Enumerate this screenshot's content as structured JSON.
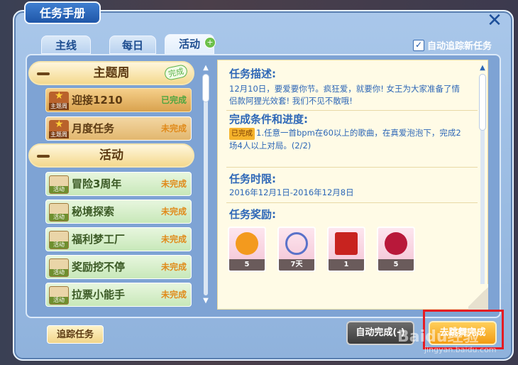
{
  "window": {
    "title": "任务手册",
    "close_icon": "close-icon"
  },
  "tabs": [
    {
      "label": "主线"
    },
    {
      "label": "每日"
    },
    {
      "label": "活动",
      "active": true
    }
  ],
  "auto_track": {
    "label": "自动追踪新任务",
    "checked": true
  },
  "list": {
    "categories": [
      {
        "label": "主题周",
        "badge": "完成"
      },
      {
        "label": "活动"
      }
    ],
    "theme_items": [
      {
        "icon_tag": "主题周",
        "name": "迎接1210",
        "status": "已完成"
      },
      {
        "icon_tag": "主题周",
        "name": "月度任务",
        "status": "未完成"
      }
    ],
    "activity_items": [
      {
        "icon_tag": "活动",
        "name": "冒险3周年",
        "status": "未完成"
      },
      {
        "icon_tag": "活动",
        "name": "秘境探索",
        "status": "未完成"
      },
      {
        "icon_tag": "活动",
        "name": "福利梦工厂",
        "status": "未完成"
      },
      {
        "icon_tag": "活动",
        "name": "奖励挖不停",
        "status": "未完成"
      },
      {
        "icon_tag": "活动",
        "name": "拉票小能手",
        "status": "未完成"
      }
    ]
  },
  "detail": {
    "desc_title": "任务描述:",
    "desc_text": "12月10日，要爱要你节。疯狂爱，就要你! 女王为大家准备了情侣款阿狸光效套! 我们不见不散哦!",
    "cond_title": "完成条件和进度:",
    "cond_tag": "已完成",
    "cond_text": "1.任意一首bpm在60以上的歌曲，在真爱泡泡下，完成2场4人以上对局。(2/2)",
    "time_title": "任务时限:",
    "time_text": "2016年12月1日-2016年12月8日",
    "reward_title": "任务奖励:",
    "rewards": [
      {
        "count": "5",
        "color": "#f39a1e"
      },
      {
        "count": "7天",
        "color": "#5a72c9"
      },
      {
        "count": "1",
        "color": "#c8231f"
      },
      {
        "count": "5",
        "color": "#b8183a"
      }
    ]
  },
  "buttons": {
    "track": "追踪任务",
    "auto_complete": "自动完成(-)",
    "go": "去跳舞完成"
  },
  "watermark": {
    "main": "Baidu经验",
    "sub": "jingyan.baidu.com"
  }
}
